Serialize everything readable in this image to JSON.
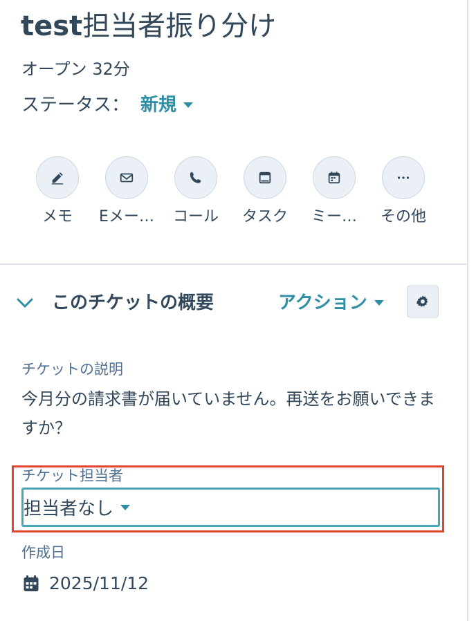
{
  "ticket": {
    "title_prefix": "test",
    "title_suffix": "担当者振り分け",
    "open_status": "オープン 32分",
    "status_label": "ステータス：",
    "status_value": "新規"
  },
  "action_buttons": [
    {
      "label": "メモ",
      "icon": "edit-icon"
    },
    {
      "label": "Eメー…",
      "icon": "email-icon"
    },
    {
      "label": "コール",
      "icon": "phone-icon"
    },
    {
      "label": "タスク",
      "icon": "task-icon"
    },
    {
      "label": "ミー…",
      "icon": "calendar-icon"
    },
    {
      "label": "その他",
      "icon": "more-icon"
    }
  ],
  "overview": {
    "section_title": "このチケットの概要",
    "actions_label": "アクション",
    "description_label": "チケットの説明",
    "description_value": "今月分の請求書が届いていません。再送をお願いできますか？",
    "owner_label": "チケット担当者",
    "owner_value": "担当者なし",
    "created_label": "作成日",
    "created_value": "2025/11/12"
  },
  "colors": {
    "accent": "#2e8ea6",
    "text": "#33475b",
    "highlight_outline": "#e0452e"
  }
}
